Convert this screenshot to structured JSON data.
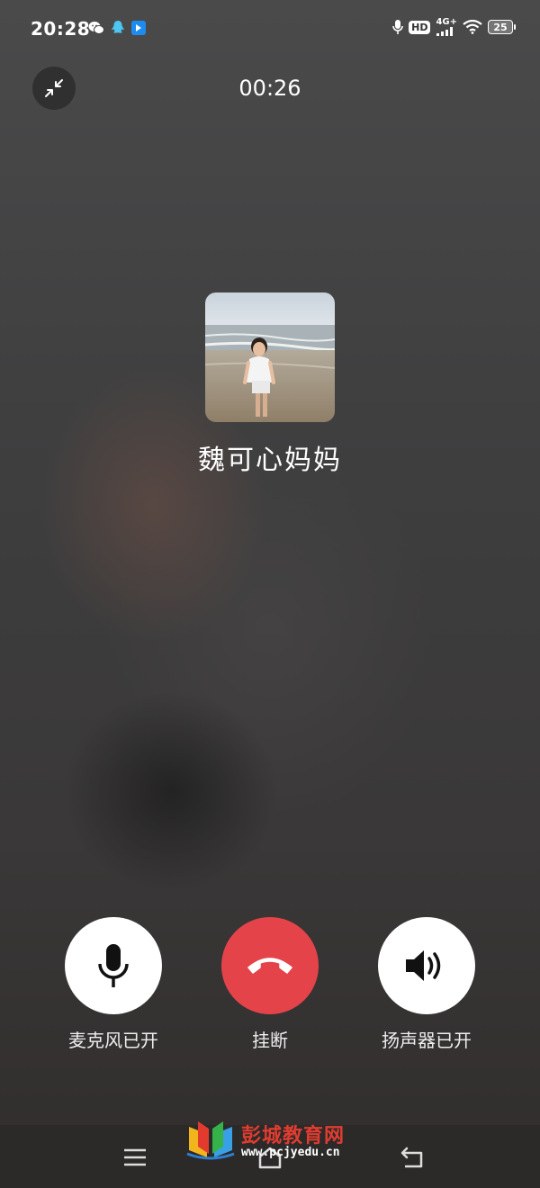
{
  "status_bar": {
    "time": "20:28",
    "network": "4G+",
    "hd": "HD",
    "battery": "25",
    "left_icons": [
      "wechat-icon",
      "qq-icon",
      "app-icon"
    ],
    "right_icons": [
      "mic-icon",
      "hd-icon",
      "signal-icon",
      "wifi-icon",
      "battery-icon"
    ]
  },
  "call": {
    "timer": "00:26",
    "caller_name": "魏可心妈妈"
  },
  "controls": {
    "mic_label": "麦克风已开",
    "hangup_label": "挂断",
    "speaker_label": "扬声器已开"
  },
  "watermark": {
    "title": "彭城教育网",
    "url": "www.pcjyedu.cn"
  },
  "colors": {
    "hangup": "#e5434a",
    "control_bg": "#ffffff"
  }
}
